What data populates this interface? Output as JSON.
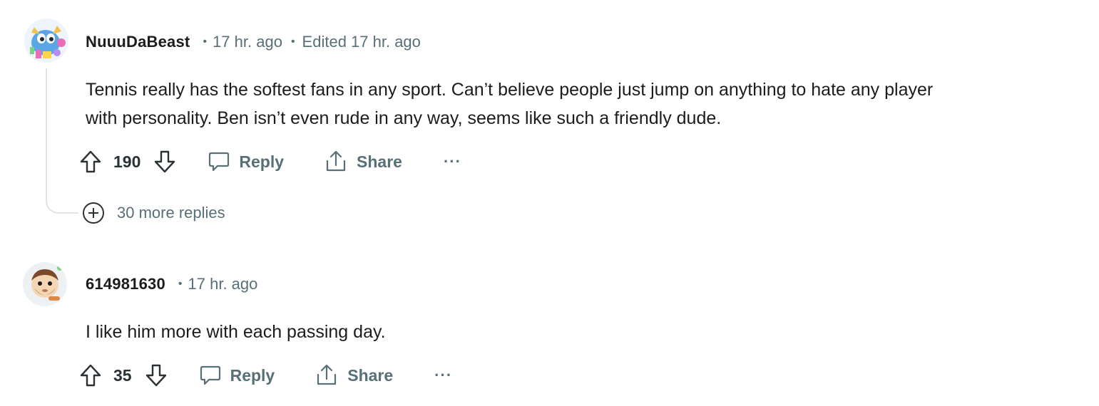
{
  "comments": [
    {
      "author": "NuuuDaBeast",
      "time": "17 hr. ago",
      "edited": "Edited 17 hr. ago",
      "body_line1": "Tennis really has the softest fans in any sport. Can’t believe people just jump on anything to hate any player",
      "body_line2": "with personality. Ben isn’t even rude in any way, seems like such a friendly dude.",
      "score": "190",
      "reply_label": "Reply",
      "share_label": "Share",
      "more_label": "···",
      "more_replies": "30 more replies",
      "avatar_icon": "snoo-avatar-blue-dragon"
    },
    {
      "author": "614981630",
      "time": "17 hr. ago",
      "body_line1": "I like him more with each passing day.",
      "score": "35",
      "reply_label": "Reply",
      "share_label": "Share",
      "more_label": "···",
      "avatar_icon": "snoo-avatar-bearded"
    }
  ],
  "icons": {
    "upvote": "upvote-arrow-icon",
    "downvote": "downvote-arrow-icon",
    "reply": "speech-bubble-icon",
    "share": "share-icon",
    "expand": "plus-circle-icon"
  },
  "colors": {
    "text": "#1c1c1c",
    "muted": "#576f76",
    "thread_line": "#dfe3e6"
  }
}
